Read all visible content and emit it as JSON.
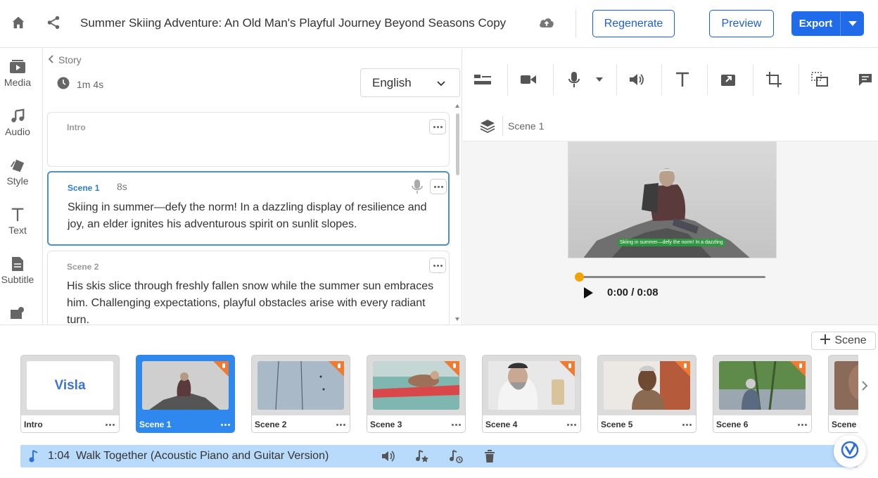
{
  "header": {
    "title": "Summer Skiing Adventure: An Old Man's Playful Journey Beyond Seasons Copy",
    "regenerate_label": "Regenerate",
    "preview_label": "Preview",
    "export_label": "Export"
  },
  "rail": {
    "items": [
      {
        "label": "Media",
        "icon": "media-icon"
      },
      {
        "label": "Audio",
        "icon": "music-note-icon"
      },
      {
        "label": "Style",
        "icon": "style-icon"
      },
      {
        "label": "Text",
        "icon": "text-icon"
      },
      {
        "label": "Subtitle",
        "icon": "subtitle-icon"
      },
      {
        "label": "",
        "icon": "image-icon"
      }
    ]
  },
  "story": {
    "back_label": "Story",
    "duration": "1m 4s",
    "language": "English",
    "cards": [
      {
        "tag": "Intro",
        "duration": "",
        "text": ""
      },
      {
        "tag": "Scene 1",
        "duration": "8s",
        "text": "Skiing in summer—defy the norm! In a dazzling display of resilience and joy, an elder ignites his adventurous spirit on sunlit slopes."
      },
      {
        "tag": "Scene 2",
        "duration": "",
        "text": "His skis slice through freshly fallen snow while the summer sun embraces him. Challenging expectations, playful obstacles arise with every radiant turn."
      }
    ]
  },
  "editor": {
    "scene_label": "Scene 1",
    "caption_text": "Skiing in summer—defy the norm! In a dazzling",
    "time_display": "0:00 / 0:08",
    "progress": 0.0
  },
  "timeline": {
    "add_scene_label": "Scene",
    "thumbs": [
      {
        "name": "Intro",
        "logo": "Visla"
      },
      {
        "name": "Scene 1"
      },
      {
        "name": "Scene 2"
      },
      {
        "name": "Scene 3"
      },
      {
        "name": "Scene 4"
      },
      {
        "name": "Scene 5"
      },
      {
        "name": "Scene 6"
      },
      {
        "name": "Scene"
      }
    ]
  },
  "music": {
    "length": "1:04",
    "title": "Walk Together (Acoustic Piano and Guitar Version)"
  },
  "colors": {
    "accent": "#1f6bea",
    "active_scene": "#2f88ee",
    "music_bar": "#b9dbfb",
    "progress": "#f0a500",
    "mic_badge": "#f07a30"
  }
}
